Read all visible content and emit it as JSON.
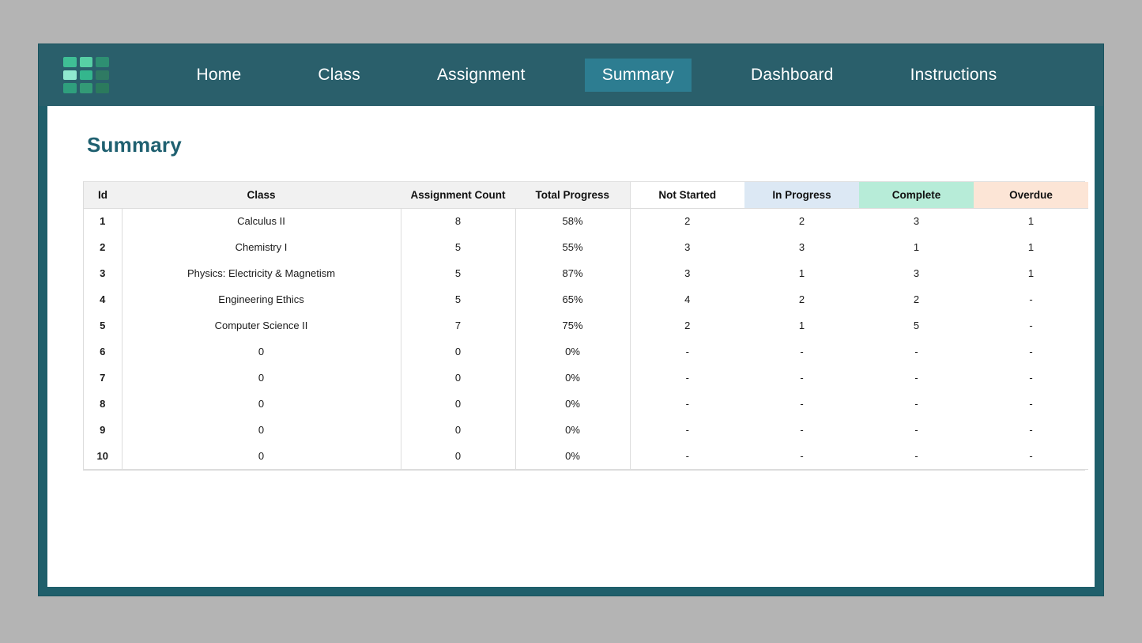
{
  "colors": {
    "frame": "#1f5f6b",
    "navbar": "#2a5f6b",
    "nav_active": "#2d7d91",
    "title": "#1f6070",
    "page_bg": "#b4b4b4",
    "header_bg": "#f1f1f1",
    "not_started": "#ffffff",
    "in_progress": "#dce8f4",
    "complete": "#b7ecd8",
    "overdue": "#fce5d6"
  },
  "logo": {
    "name": "app-logo",
    "tiles": [
      "#3fbf95",
      "#57cfa5",
      "#2e8f72",
      "#8fe8cf",
      "#34b68d",
      "#2f7a63",
      "#2f9f7d",
      "#339a76",
      "#2b7a5d"
    ]
  },
  "nav": {
    "items": [
      {
        "label": "Home",
        "active": false
      },
      {
        "label": "Class",
        "active": false
      },
      {
        "label": "Assignment",
        "active": false
      },
      {
        "label": "Summary",
        "active": true
      },
      {
        "label": "Dashboard",
        "active": false
      },
      {
        "label": "Instructions",
        "active": false
      }
    ]
  },
  "page": {
    "title": "Summary"
  },
  "table": {
    "headers": {
      "id": "Id",
      "class": "Class",
      "assignment_count": "Assignment Count",
      "total_progress": "Total Progress",
      "not_started": "Not Started",
      "in_progress": "In Progress",
      "complete": "Complete",
      "overdue": "Overdue"
    },
    "rows": [
      {
        "id": "1",
        "class": "Calculus II",
        "assignment_count": "8",
        "total_progress": "58%",
        "not_started": "2",
        "in_progress": "2",
        "complete": "3",
        "overdue": "1"
      },
      {
        "id": "2",
        "class": "Chemistry I",
        "assignment_count": "5",
        "total_progress": "55%",
        "not_started": "3",
        "in_progress": "3",
        "complete": "1",
        "overdue": "1"
      },
      {
        "id": "3",
        "class": "Physics: Electricity & Magnetism",
        "assignment_count": "5",
        "total_progress": "87%",
        "not_started": "3",
        "in_progress": "1",
        "complete": "3",
        "overdue": "1"
      },
      {
        "id": "4",
        "class": "Engineering Ethics",
        "assignment_count": "5",
        "total_progress": "65%",
        "not_started": "4",
        "in_progress": "2",
        "complete": "2",
        "overdue": "-"
      },
      {
        "id": "5",
        "class": "Computer Science II",
        "assignment_count": "7",
        "total_progress": "75%",
        "not_started": "2",
        "in_progress": "1",
        "complete": "5",
        "overdue": "-"
      },
      {
        "id": "6",
        "class": "0",
        "assignment_count": "0",
        "total_progress": "0%",
        "not_started": "-",
        "in_progress": "-",
        "complete": "-",
        "overdue": "-"
      },
      {
        "id": "7",
        "class": "0",
        "assignment_count": "0",
        "total_progress": "0%",
        "not_started": "-",
        "in_progress": "-",
        "complete": "-",
        "overdue": "-"
      },
      {
        "id": "8",
        "class": "0",
        "assignment_count": "0",
        "total_progress": "0%",
        "not_started": "-",
        "in_progress": "-",
        "complete": "-",
        "overdue": "-"
      },
      {
        "id": "9",
        "class": "0",
        "assignment_count": "0",
        "total_progress": "0%",
        "not_started": "-",
        "in_progress": "-",
        "complete": "-",
        "overdue": "-"
      },
      {
        "id": "10",
        "class": "0",
        "assignment_count": "0",
        "total_progress": "0%",
        "not_started": "-",
        "in_progress": "-",
        "complete": "-",
        "overdue": "-"
      }
    ]
  }
}
